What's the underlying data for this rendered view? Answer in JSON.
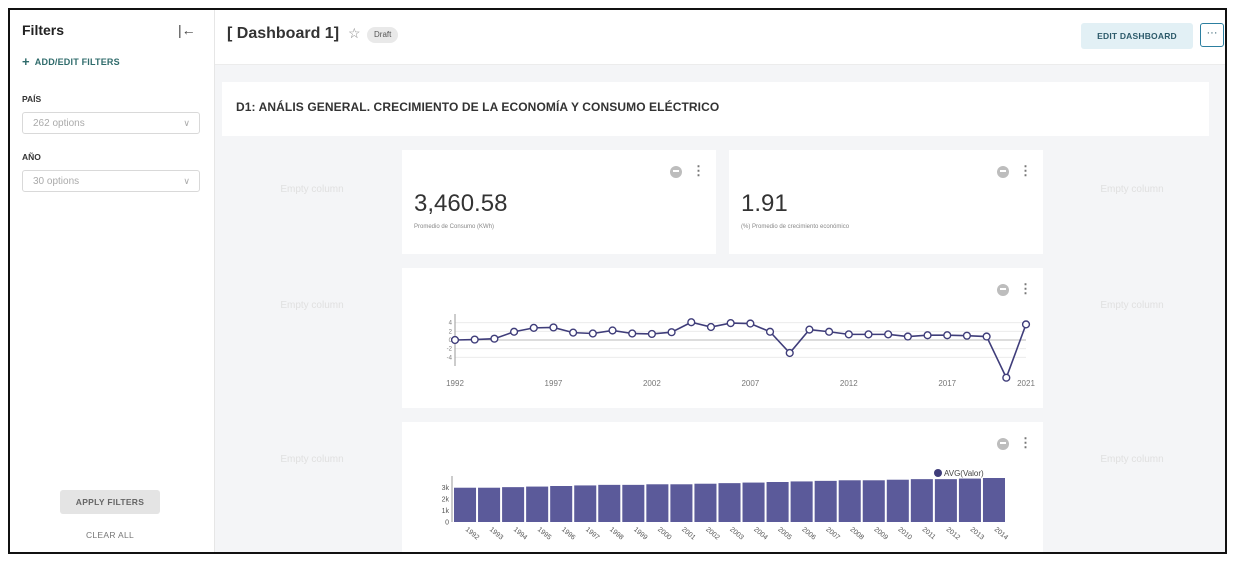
{
  "sidebar": {
    "title": "Filters",
    "collapse_icon": "|←",
    "add_filters": "ADD/EDIT FILTERS",
    "filters": [
      {
        "label": "PAÍS",
        "value": "262 options"
      },
      {
        "label": "AÑO",
        "value": "30 options"
      }
    ],
    "apply": "APPLY FILTERS",
    "clear": "CLEAR ALL"
  },
  "header": {
    "title": "[ Dashboard 1]",
    "star_icon": "☆",
    "badge": "Draft",
    "edit_button": "EDIT DASHBOARD",
    "more_icon": "···"
  },
  "section": {
    "title": "D1: ANÁLIS GENERAL. CRECIMIENTO DE LA ECONOMÍA Y CONSUMO ELÉCTRICO"
  },
  "empty_column_label": "Empty column",
  "kpis": [
    {
      "value": "3,460.58",
      "label": "Promedio de Consumo (KWh)"
    },
    {
      "value": "1.91",
      "label": "(%) Promedio de crecimiento económico"
    }
  ],
  "chart_data": [
    {
      "type": "line",
      "x": [
        1992,
        1993,
        1994,
        1995,
        1996,
        1997,
        1998,
        1999,
        2000,
        2001,
        2002,
        2003,
        2004,
        2005,
        2006,
        2007,
        2008,
        2009,
        2010,
        2011,
        2012,
        2013,
        2014,
        2015,
        2016,
        2017,
        2018,
        2019,
        2020,
        2021
      ],
      "values": [
        0,
        0.1,
        0.3,
        1.9,
        2.8,
        2.9,
        1.7,
        1.5,
        2.2,
        1.5,
        1.4,
        1.8,
        4.1,
        3.0,
        3.9,
        3.8,
        1.9,
        -3.0,
        2.4,
        1.9,
        1.3,
        1.3,
        1.3,
        0.8,
        1.1,
        1.1,
        1.0,
        0.8,
        -8.7,
        3.6
      ],
      "xticks": [
        "1992",
        "1997",
        "2002",
        "2007",
        "2012",
        "2017",
        "2021"
      ],
      "yticks": [
        "4",
        "2",
        "0",
        "-2",
        "-4"
      ],
      "ylim": [
        -6,
        6
      ],
      "grid": true
    },
    {
      "type": "bar",
      "legend": "AVG(Valor)",
      "legend_color": "#3f3d7a",
      "bar_color": "#5b5a9a",
      "categories": [
        "1992",
        "1993",
        "1994",
        "1995",
        "1996",
        "1997",
        "1998",
        "1999",
        "2000",
        "2001",
        "2002",
        "2003",
        "2004",
        "2005",
        "2006",
        "2007",
        "2008",
        "2009",
        "2010",
        "2011",
        "2012",
        "2013",
        "2014"
      ],
      "values": [
        3000,
        3000,
        3050,
        3100,
        3150,
        3200,
        3250,
        3250,
        3300,
        3300,
        3350,
        3400,
        3450,
        3500,
        3550,
        3600,
        3650,
        3650,
        3700,
        3750,
        3750,
        3800,
        3850
      ],
      "yticks": [
        "3k",
        "2k",
        "1k",
        "0"
      ],
      "ylim": [
        0,
        3850
      ]
    }
  ]
}
